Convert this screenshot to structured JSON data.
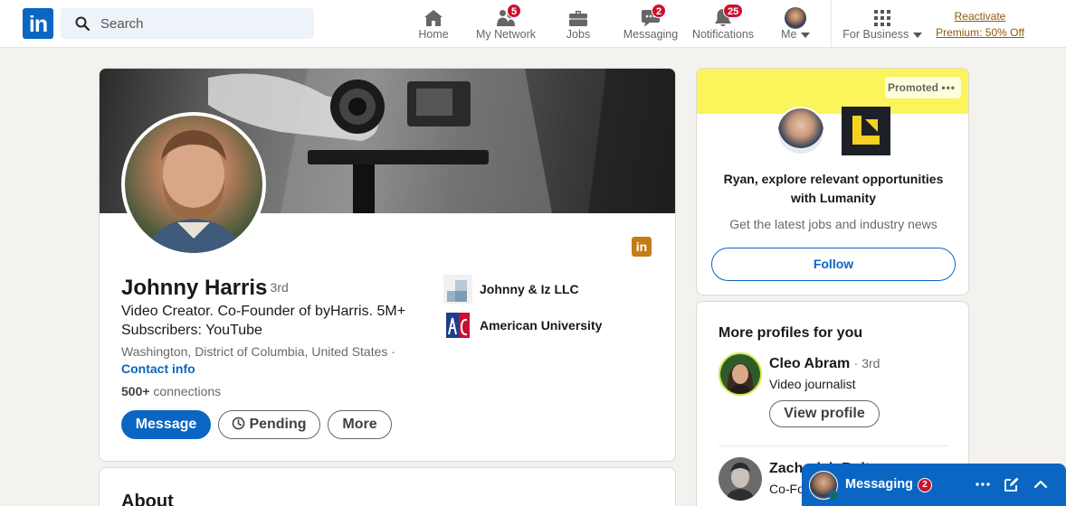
{
  "brand": {
    "logo_text": "in"
  },
  "search": {
    "placeholder": "Search"
  },
  "nav": {
    "items": [
      {
        "label": "Home",
        "icon": "home-icon"
      },
      {
        "label": "My Network",
        "icon": "people-icon",
        "badge": "5"
      },
      {
        "label": "Jobs",
        "icon": "briefcase-icon"
      },
      {
        "label": "Messaging",
        "icon": "chat-icon",
        "badge": "2"
      },
      {
        "label": "Notifications",
        "icon": "bell-icon",
        "badge": "25"
      },
      {
        "label": "Me",
        "icon": "profile-photo"
      },
      {
        "label": "For Business",
        "icon": "grid-icon"
      }
    ],
    "premium_line1": "Reactivate",
    "premium_line2": "Premium: 50% Off"
  },
  "profile": {
    "name": "Johnny Harris",
    "degree": "· 3rd",
    "headline": "Video Creator. Co-Founder of byHarris. 5M+ Subscribers: YouTube",
    "location": "Washington, District of Columbia, United States ·",
    "contact_info": "Contact info",
    "connections_count": "500+",
    "connections_label": " connections",
    "companies": [
      {
        "name": "Johnny & Iz LLC"
      },
      {
        "name": "American University"
      }
    ],
    "buttons": {
      "message": "Message",
      "pending": "Pending",
      "more": "More"
    },
    "linkedin_badge": "in"
  },
  "about": {
    "title": "About"
  },
  "ad": {
    "promoted": "Promoted",
    "dots": "•••",
    "title": "Ryan, explore relevant opportunities with Lumanity",
    "subtitle": "Get the latest jobs and industry news",
    "follow": "Follow"
  },
  "more_profiles": {
    "title": "More profiles for you",
    "people": [
      {
        "name": "Cleo Abram",
        "degree": "· 3rd",
        "headline": "Video journalist",
        "button": "View profile"
      },
      {
        "name": "Zachariah Rolt",
        "degree": "",
        "headline": "Co-Fo",
        "button": ""
      }
    ]
  },
  "messaging": {
    "label": "Messaging",
    "badge": "2"
  },
  "colors": {
    "brand": "#0a66c2",
    "badge": "#cb112d",
    "premium": "#915907",
    "ad_banner": "#fbf45a"
  }
}
